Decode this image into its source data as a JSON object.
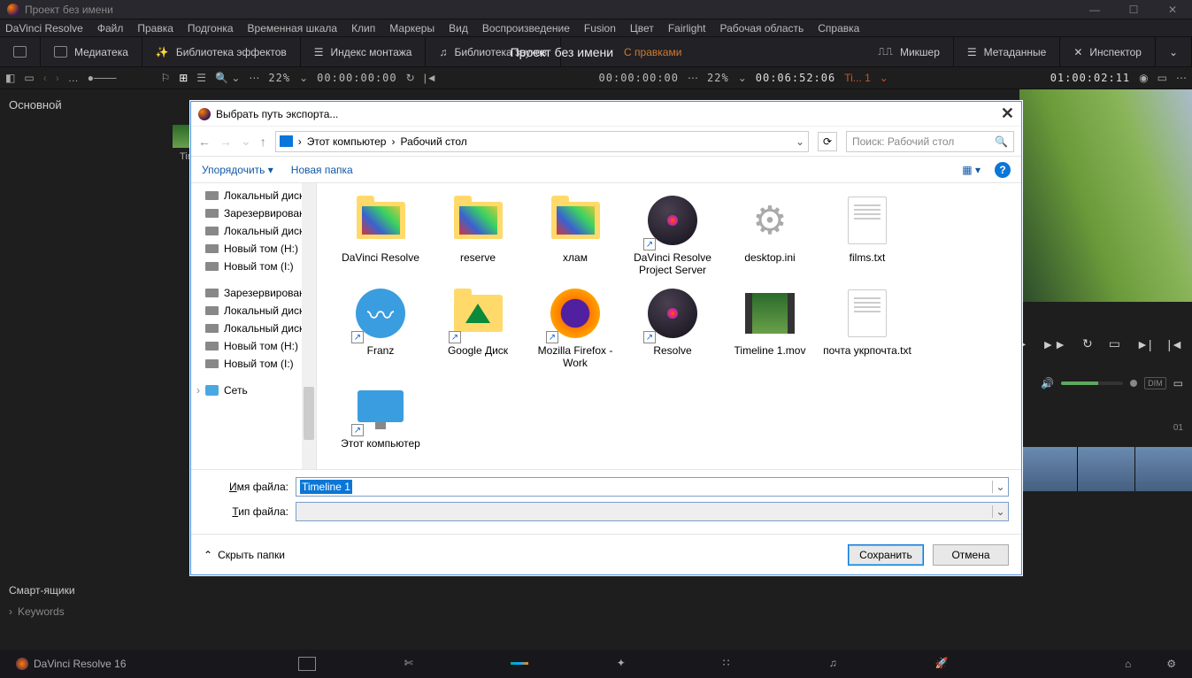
{
  "window": {
    "title": "Проект без имени"
  },
  "menubar": [
    "DaVinci Resolve",
    "Файл",
    "Правка",
    "Подгонка",
    "Временная шкала",
    "Клип",
    "Маркеры",
    "Вид",
    "Воспроизведение",
    "Fusion",
    "Цвет",
    "Fairlight",
    "Рабочая область",
    "Справка"
  ],
  "panels": {
    "left": [
      {
        "label": "Медиатека"
      },
      {
        "label": "Библиотека эффектов"
      },
      {
        "label": "Индекс монтажа"
      },
      {
        "label": "Библиотека звуков"
      }
    ],
    "right": [
      {
        "label": "Микшер"
      },
      {
        "label": "Метаданные"
      },
      {
        "label": "Инспектор"
      }
    ],
    "center_title": "Проект без имени",
    "center_status": "С правками"
  },
  "toolrow": {
    "zoom_left": "22%",
    "tc_left_a": "00:00:00:00",
    "tc_left_b": "00:00:00:00",
    "zoom_right": "22%",
    "tc_duration": "00:06:52:06",
    "timeline_name": "Ti... 1",
    "tc_current": "01:00:02:11"
  },
  "sidebar": {
    "main": "Основной",
    "smart": "Смарт-ящики",
    "keywords": "Keywords"
  },
  "volume": {
    "dim": "DIM"
  },
  "thumb_label": "Time",
  "timeline_marker": "01",
  "dialog": {
    "title": "Выбрать путь экспорта...",
    "breadcrumb": {
      "pc": "Этот компьютер",
      "folder": "Рабочий стол"
    },
    "search_placeholder": "Поиск: Рабочий стол",
    "organize": "Упорядочить",
    "new_folder": "Новая папка",
    "tree": [
      "Локальный диск",
      "Зарезервирован",
      "Локальный диск",
      "Новый том (H:)",
      "Новый том (I:)",
      "Зарезервировано",
      "Локальный диск",
      "Локальный диск",
      "Новый том (H:)",
      "Новый том (I:)",
      "Сеть"
    ],
    "files": [
      {
        "name": "DaVinci Resolve",
        "type": "folder-thumb"
      },
      {
        "name": "reserve",
        "type": "folder-thumb"
      },
      {
        "name": "хлам",
        "type": "folder-thumb"
      },
      {
        "name": "DaVinci Resolve Project Server",
        "type": "resolve",
        "shortcut": true
      },
      {
        "name": "desktop.ini",
        "type": "gear"
      },
      {
        "name": "films.txt",
        "type": "txt"
      },
      {
        "name": "Franz",
        "type": "franz",
        "shortcut": true
      },
      {
        "name": "Google Диск",
        "type": "gdrive",
        "shortcut": true
      },
      {
        "name": "Mozilla Firefox - Work",
        "type": "firefox",
        "shortcut": true
      },
      {
        "name": "Resolve",
        "type": "resolve",
        "shortcut": true
      },
      {
        "name": "Timeline 1.mov",
        "type": "video"
      },
      {
        "name": "почта укрпочта.txt",
        "type": "txt"
      },
      {
        "name": "Этот компьютер",
        "type": "monitor",
        "shortcut": true
      }
    ],
    "filename_label": "Имя файла:",
    "filetype_label": "Тип файла:",
    "filename_value": "Timeline 1",
    "hide_folders": "Скрыть папки",
    "save": "Сохранить",
    "cancel": "Отмена"
  },
  "bottom": {
    "app": "DaVinci Resolve 16"
  }
}
